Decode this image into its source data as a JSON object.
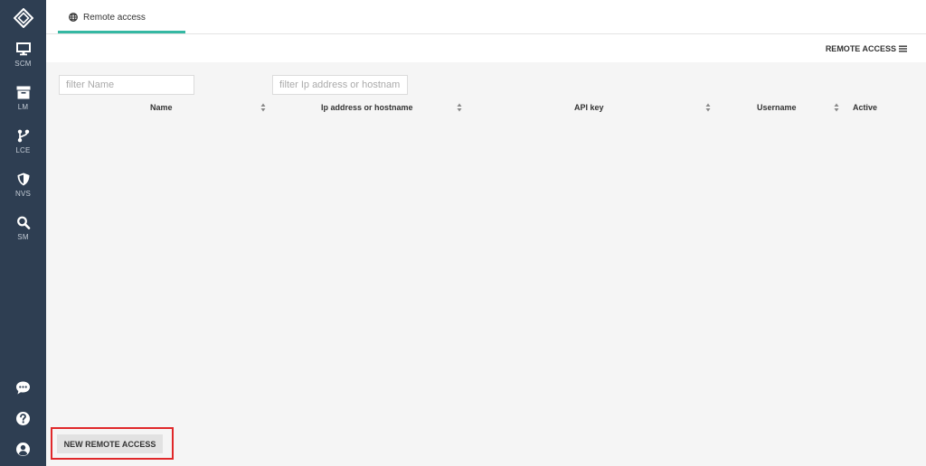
{
  "sidebar": {
    "items": [
      {
        "label": "SCM",
        "icon": "monitor-icon"
      },
      {
        "label": "LM",
        "icon": "archive-icon"
      },
      {
        "label": "LCE",
        "icon": "branch-icon"
      },
      {
        "label": "NVS",
        "icon": "shield-icon"
      },
      {
        "label": "SM",
        "icon": "search-icon"
      }
    ],
    "bottom_icons": [
      "chat-icon",
      "help-icon",
      "user-icon"
    ]
  },
  "tab": {
    "label": "Remote access",
    "icon": "globe-icon"
  },
  "header": {
    "menu_label": "REMOTE ACCESS",
    "menu_icon": "hamburger-icon"
  },
  "filters": {
    "name_placeholder": "filter Name",
    "host_placeholder": "filter Ip address or hostnam"
  },
  "table": {
    "columns": [
      "Name",
      "Ip address or hostname",
      "API key",
      "Username",
      "Active"
    ]
  },
  "actions": {
    "new_label": "NEW REMOTE ACCESS"
  },
  "colors": {
    "sidebar": "#2e3e52",
    "accent": "#35b8a3",
    "highlight": "#e0282a"
  }
}
